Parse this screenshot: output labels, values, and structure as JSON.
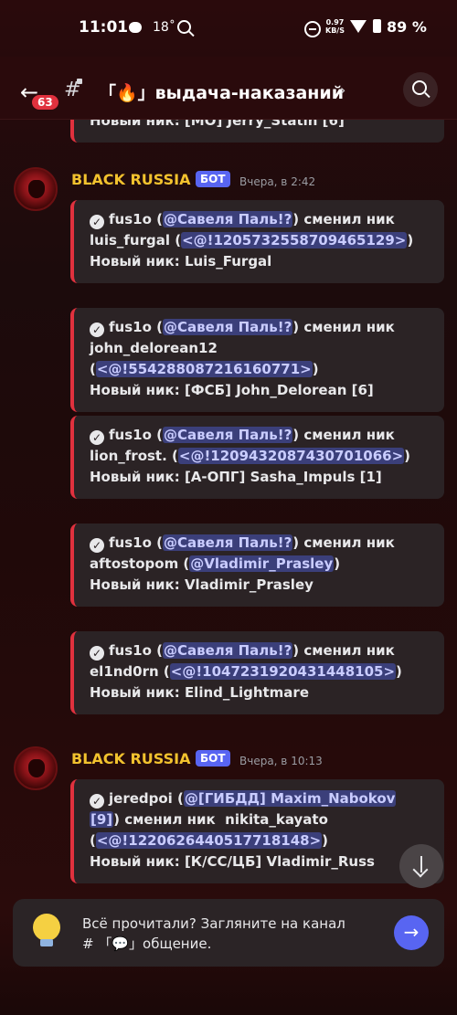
{
  "status_bar": {
    "time": "11:01",
    "temp": "18˚",
    "net_speed": "0.97",
    "net_unit": "KB/S",
    "battery": "89 %"
  },
  "header": {
    "badge": "63",
    "hash": "#",
    "title": "「🔥」выдача-наказаний",
    "chevron": "›"
  },
  "partial_text": "Новый ник: [МО] Jerry_Statin [6]",
  "groups": [
    {
      "author": "BLACK RUSSIA",
      "bot_tag": "БОТ",
      "time": "Вчера, в 2:42",
      "embeds": [
        {
          "actor": "fus1o",
          "mention": "@Савеля Паль!?",
          "action": "сменил ник",
          "old_nick": "luis_furgal",
          "id": "<@!1205732558709465129>",
          "new_label": "Новый ник:",
          "new_nick": "Luis_Furgal"
        },
        {
          "actor": "fus1o",
          "mention": "@Савеля Паль!?",
          "action": "сменил ник",
          "old_nick": "john_delorean12",
          "id": "<@!554288087216160771>",
          "new_label": "Новый ник:",
          "new_nick": "[ФСБ] John_Delorean [6]"
        },
        {
          "actor": "fus1o",
          "mention": "@Савеля Паль!?",
          "action": "сменил ник",
          "old_nick": "lion_frost.",
          "id": "<@!1209432087430701066>",
          "new_label": "Новый ник:",
          "new_nick": "[А-ОПГ] Sasha_Impuls [1]"
        },
        {
          "actor": "fus1o",
          "mention": "@Савеля Паль!?",
          "action": "сменил ник",
          "old_nick": "aftostopom",
          "id": "@Vladimir_Prasley",
          "new_label": "Новый ник:",
          "new_nick": "Vladimir_Prasley"
        },
        {
          "actor": "fus1o",
          "mention": "@Савеля Паль!?",
          "action": "сменил ник",
          "old_nick": "el1nd0rn",
          "id": "<@!1047231920431448105>",
          "new_label": "Новый ник:",
          "new_nick": "Elind_Lightmare"
        }
      ]
    },
    {
      "author": "BLACK RUSSIA",
      "bot_tag": "БОТ",
      "time": "Вчера, в 10:13",
      "embeds": [
        {
          "actor": "jeredpoi",
          "mention_a": "@[ГИБДД] Maxim_Nabokov",
          "mention_b": "[9]",
          "action": "сменил ник",
          "old_nick": "nikita_kayato",
          "id": "<@!1220626440517718148>",
          "new_label": "Новый ник:",
          "new_nick": "[К/СС/ЦБ] Vladimir_Russ"
        }
      ]
    }
  ],
  "banner": {
    "text": "Всё прочитали? Загляните на канал # 「💬」общение."
  },
  "colors": {
    "accent": "#e0313e",
    "author": "#f2c22e",
    "bot_tag": "#5865f2",
    "mention_bg": "#3b3f7a"
  }
}
